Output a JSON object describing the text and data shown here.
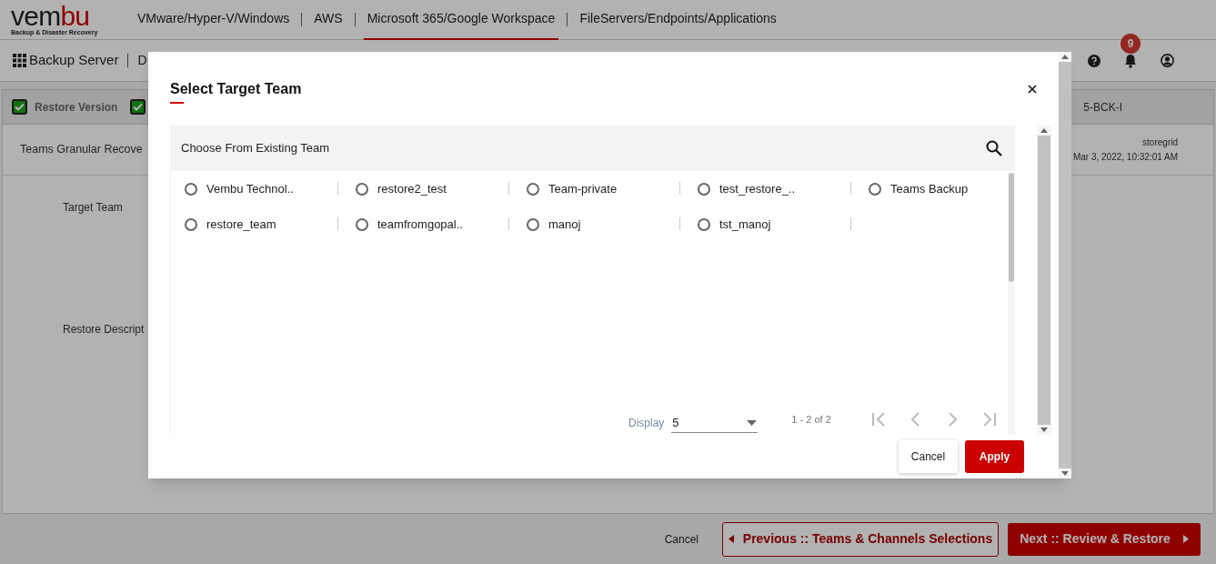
{
  "header": {
    "logo": {
      "text": "vem",
      "accent": "bu",
      "tagline": "Backup & Disaster Recovery"
    },
    "nav": [
      {
        "label": "VMware/Hyper-V/Windows",
        "selected": false
      },
      {
        "label": "AWS",
        "selected": false
      },
      {
        "label": "Microsoft 365/Google Workspace",
        "selected": true
      },
      {
        "label": "FileServers/Endpoints/Applications",
        "selected": false
      }
    ]
  },
  "toolbar": {
    "apps_label": "Backup Server",
    "cut_label": "D",
    "notification_count": "9"
  },
  "steps": [
    {
      "label": "Restore Version",
      "checked": true
    },
    {
      "checked": true
    }
  ],
  "step_tab": "5-BCK-I",
  "summary": {
    "title": "Teams Granular Recove",
    "user": "storegrid",
    "date": "Mar 3, 2022, 10:32:01 AM"
  },
  "form_labels": [
    "Target Team",
    "Restore Descript"
  ],
  "dialog": {
    "title": "Select Target Team",
    "section_title": "Choose From Existing Team",
    "teams": [
      {
        "label": "Vembu Technol..",
        "selected": false
      },
      {
        "label": "restore2_test",
        "selected": false
      },
      {
        "label": "Team-private",
        "selected": false
      },
      {
        "label": "test_restore_..",
        "selected": false
      },
      {
        "label": "Teams Backup",
        "selected": false
      },
      {
        "label": "restore_team",
        "selected": false
      },
      {
        "label": "teamfromgopal..",
        "selected": false
      },
      {
        "label": "manoj",
        "selected": false
      },
      {
        "label": "tst_manoj",
        "selected": false
      }
    ],
    "display_label": "Display",
    "page_size": "5",
    "range": "1 - 2 of 2",
    "buttons": [
      "Cancel",
      "Apply"
    ]
  },
  "footer": {
    "cancel": "Cancel",
    "previous": "Previous :: Teams & Channels Selections",
    "next": "Next :: Review & Restore"
  }
}
